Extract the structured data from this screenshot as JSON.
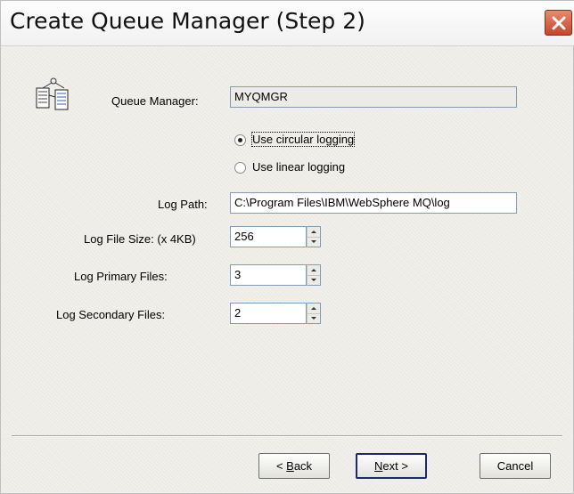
{
  "window": {
    "title": "Create Queue Manager (Step 2)"
  },
  "form": {
    "queue_manager_label": "Queue Manager:",
    "queue_manager_value": "MYQMGR",
    "logging": {
      "options": [
        "Use circular logging",
        "Use linear logging"
      ],
      "selected": "Use circular logging"
    },
    "log_path_label": "Log Path:",
    "log_path_value": "C:\\Program Files\\IBM\\WebSphere MQ\\log",
    "log_file_size_label": "Log File Size: (x 4KB)",
    "log_file_size_value": "256",
    "log_primary_files_label": "Log Primary Files:",
    "log_primary_files_value": "3",
    "log_secondary_files_label": "Log Secondary Files:",
    "log_secondary_files_value": "2"
  },
  "buttons": {
    "back": {
      "before": "< ",
      "mnemonic": "B",
      "after": "ack"
    },
    "next": {
      "mnemonic": "N",
      "after": "ext >"
    },
    "cancel": "Cancel"
  },
  "icons": {
    "close": "close-icon",
    "wizard": "queue-manager-wizard-icon"
  },
  "colors": {
    "close_button": "#c7442b",
    "field_border": "#7f9db9",
    "dialog_background": "#ecebe6"
  }
}
